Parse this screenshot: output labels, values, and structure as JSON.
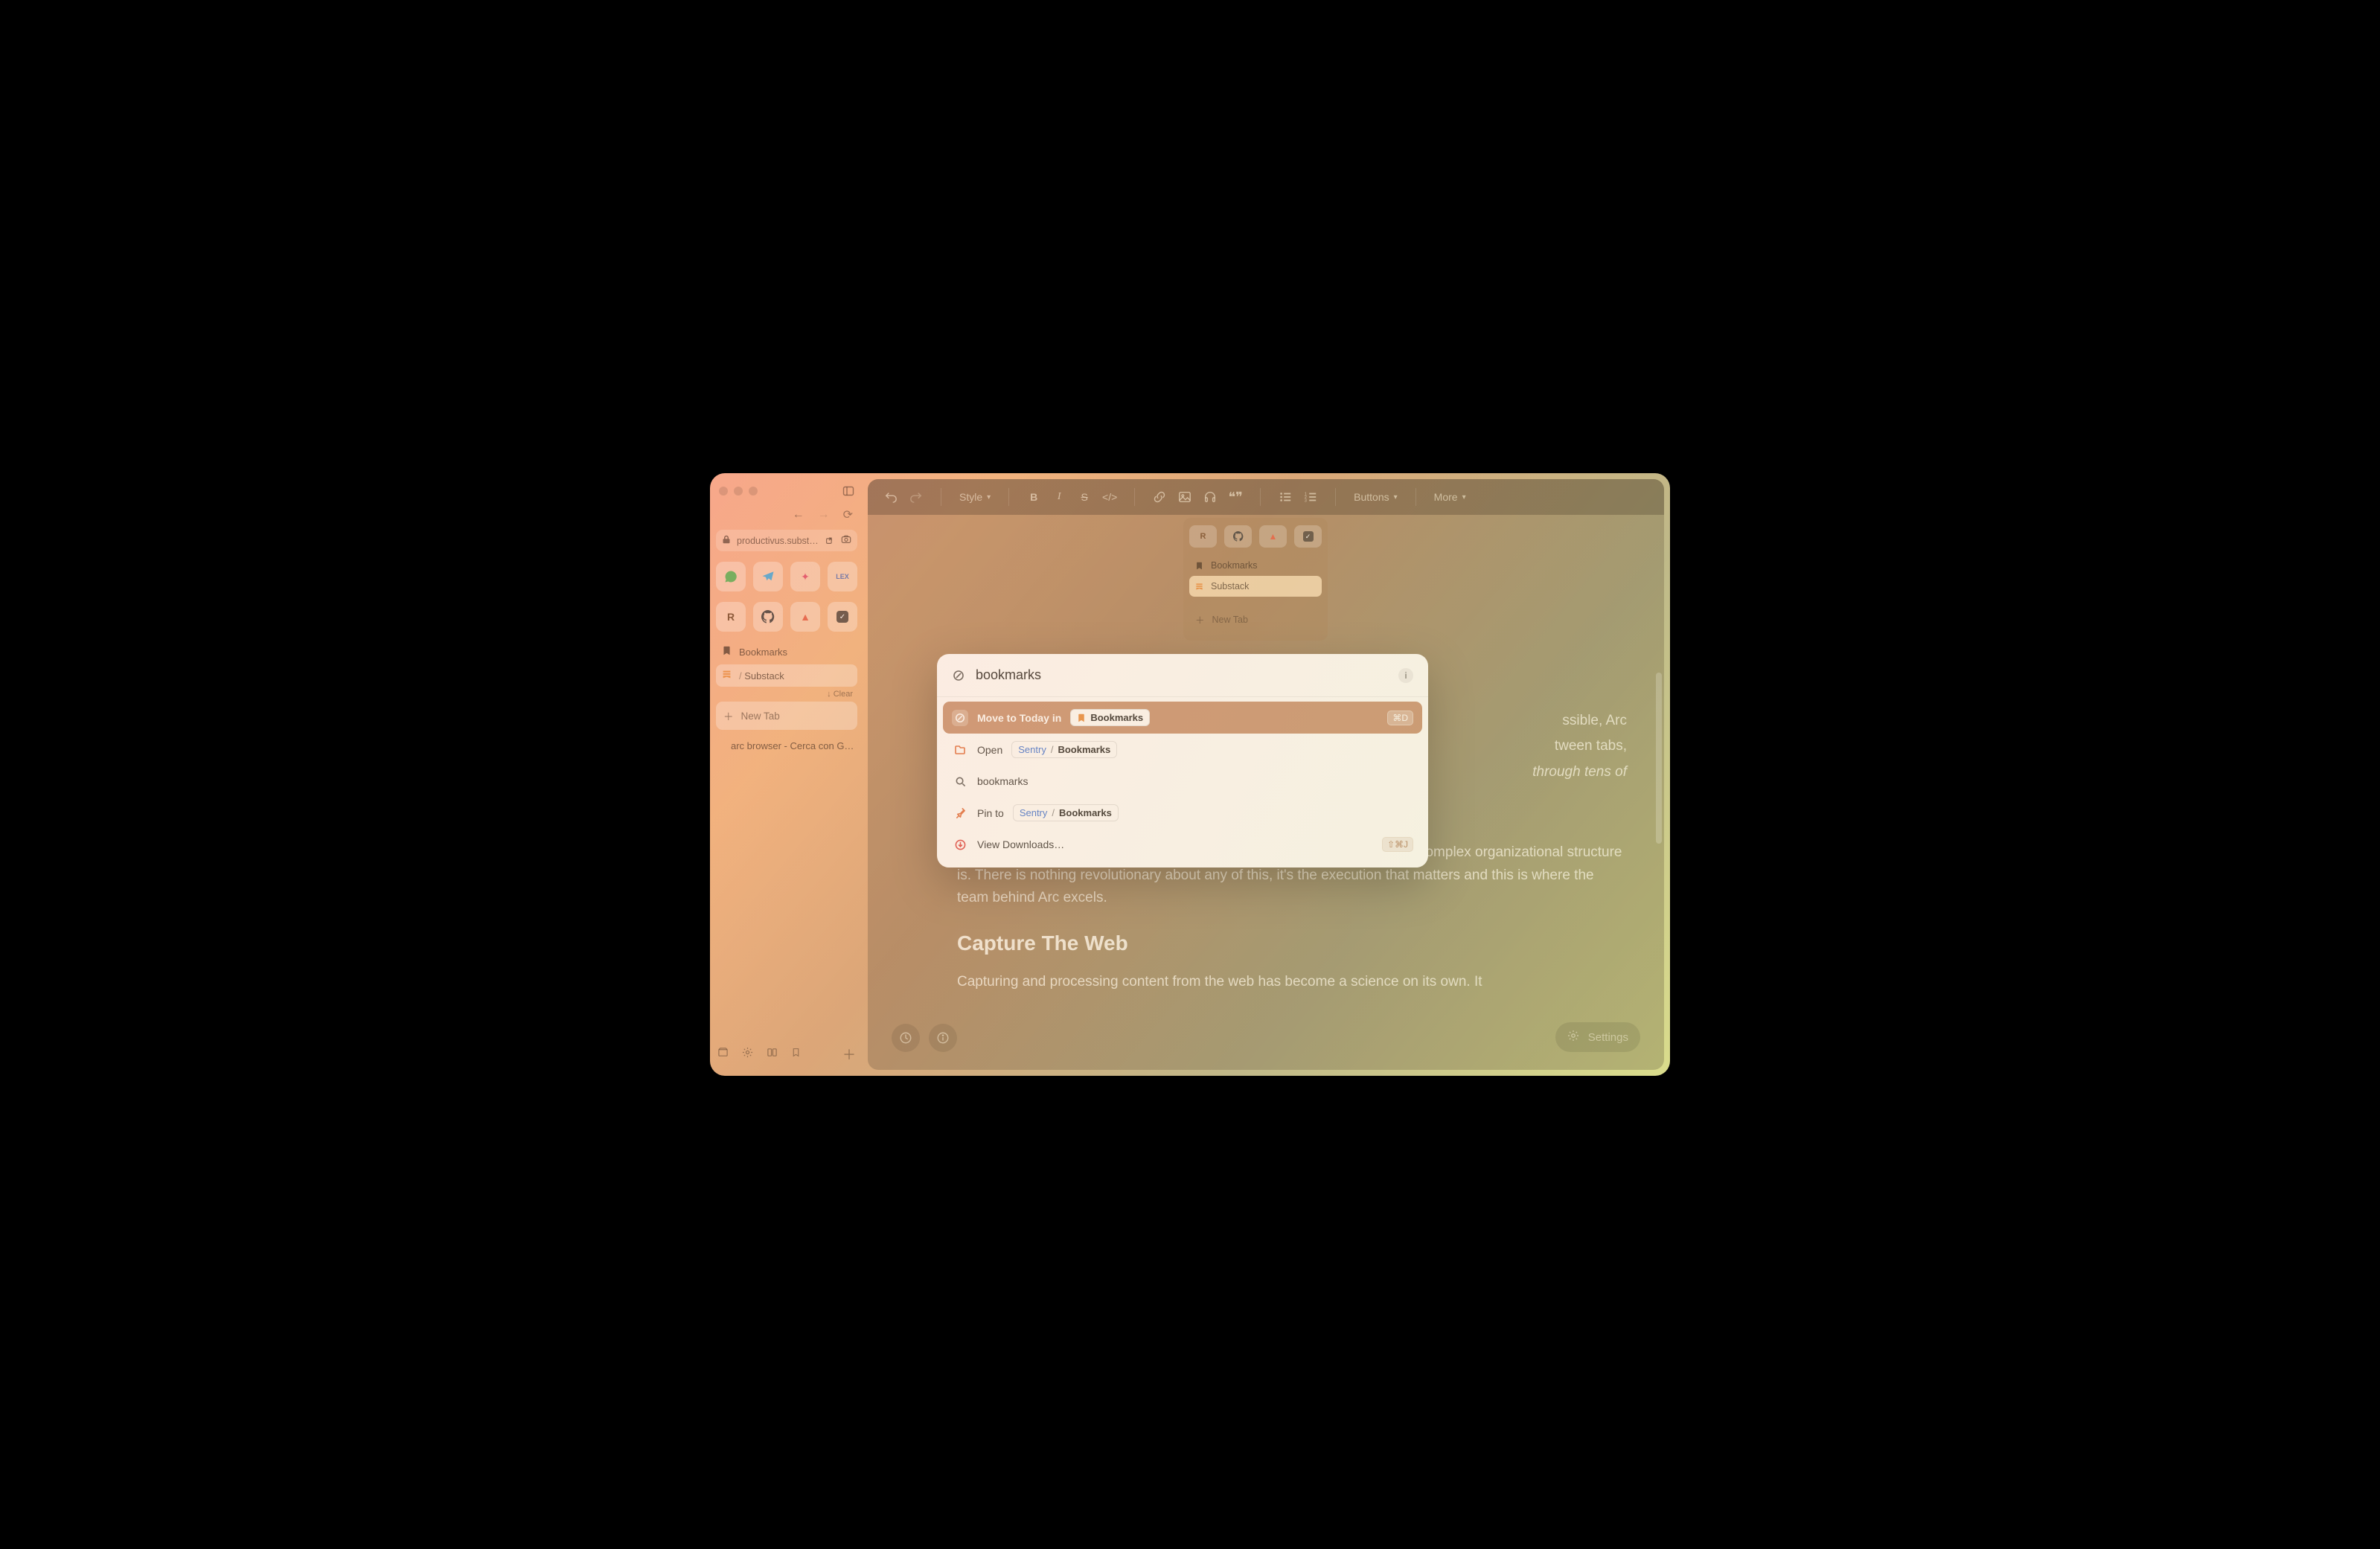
{
  "browser": {
    "url_host": "productivus.substack",
    "sidebar": {
      "favorites_row1": [
        "whatsapp-icon",
        "telegram-icon",
        "sparkle-icon",
        "lex-icon"
      ],
      "favorites_row2": [
        "r-icon",
        "github-icon",
        "sentry-icon",
        "check-icon"
      ],
      "pinned": [
        {
          "icon": "bookmark-icon",
          "label": "Bookmarks"
        },
        {
          "icon": "substack-icon",
          "label": "Substack",
          "prefix": "/ "
        }
      ],
      "clear_label": "Clear",
      "new_tab_label": "New Tab",
      "today": [
        {
          "icon": "google-icon",
          "label": "arc browser - Cerca con G…"
        }
      ]
    }
  },
  "editor": {
    "toolbar": {
      "style": "Style",
      "buttons": "Buttons",
      "more": "More"
    },
    "mini_panel": {
      "favorites": [
        "r-icon",
        "github-icon",
        "sentry-icon",
        "check-icon"
      ],
      "items": [
        {
          "icon": "bookmark-icon",
          "label": "Bookmarks"
        },
        {
          "icon": "substack-icon",
          "label": "Substack",
          "active": true
        },
        {
          "icon": "plus-icon",
          "label": "New Tab"
        }
      ]
    },
    "body": {
      "p1a": "ssible, Arc",
      "p1b": "tween tabs,",
      "p1c_em": "through tens of",
      "p2": "I hope you can see how seamless and liquid the UX is and the seemingly complex organizational structure is. There is nothing revolutionary about any of this, it's the execution that matters and this is where the team behind Arc excels.",
      "h2": "Capture The Web",
      "p3": "Capturing and processing content from the web has become a science on its own. It"
    },
    "settings_label": "Settings"
  },
  "palette": {
    "query": "bookmarks",
    "rows": {
      "move": {
        "prefix": "Move to Today in",
        "pill_label": "Bookmarks",
        "shortcut": "⌘D"
      },
      "open": {
        "label": "Open",
        "pill_sentry": "Sentry",
        "pill_slash": "/",
        "pill_bm": "Bookmarks"
      },
      "search": {
        "label": "bookmarks"
      },
      "pin": {
        "label": "Pin to",
        "pill_sentry": "Sentry",
        "pill_slash": "/",
        "pill_bm": "Bookmarks"
      },
      "downloads": {
        "label": "View Downloads…",
        "shortcut": "⇧⌘J"
      }
    }
  }
}
